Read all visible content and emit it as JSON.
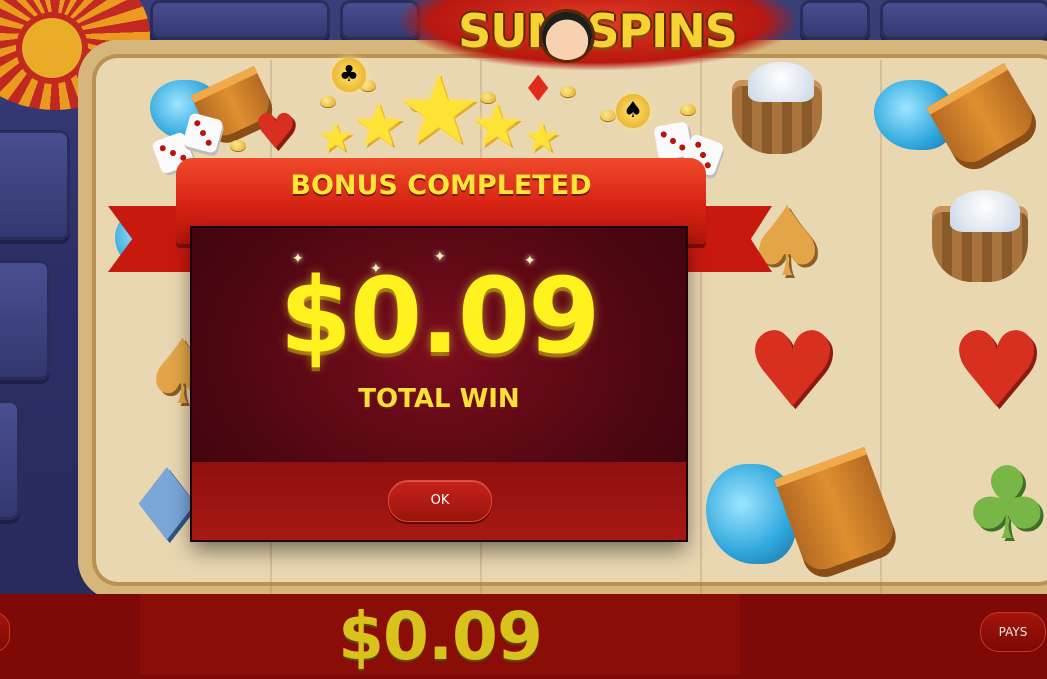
{
  "game": {
    "logo": "SUM  SPINS",
    "colors": {
      "ribbon": "#d62314",
      "gold": "#ffe43a",
      "dialog": "#4e0711",
      "bottom_bar": "#7d0a06"
    }
  },
  "dialog": {
    "title": "BONUS COMPLETED",
    "amount": "$0.09",
    "amount_label": "TOTAL WIN",
    "ok_label": "OK"
  },
  "bottom_bar": {
    "win_amount": "$0.09",
    "pays_label": "PAYS"
  },
  "symbols": [
    "water-bucket",
    "salt-basket",
    "spade",
    "heart",
    "club",
    "diamond",
    "dice"
  ]
}
